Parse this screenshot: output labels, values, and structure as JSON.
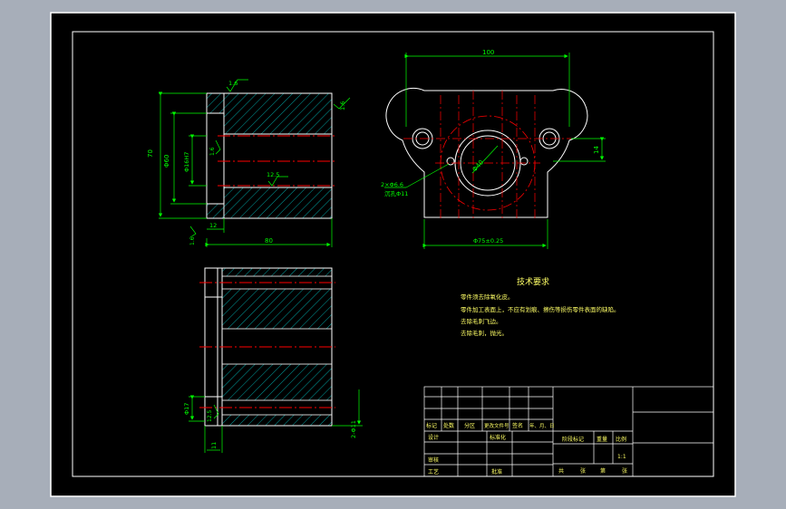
{
  "colors": {
    "app_background": "#a7aeb9",
    "canvas": "#000000",
    "border": "#ffffff",
    "dimension": "#00ff00",
    "centerline": "#ff0000",
    "hatch": "#00c8c8",
    "section_line": "#00c8c8",
    "text": "#ffff66",
    "title_text": "#ffff66"
  },
  "dims": {
    "top_chamfer": "1.6",
    "right_angle": "1.6",
    "left_height": "70",
    "outer_diameter": "Φ60",
    "inner_diameter": "Φ16H7",
    "inner_roughness": "1.6",
    "hole_roughness": "12.5",
    "flange_width": "12",
    "left_angle": "1.6",
    "total_length": "80",
    "plan_width": "100",
    "pcd_label": "Φ40",
    "center_dist": "14",
    "bolt_holes": "2×Φ6.6",
    "counterbore": "沉孔Φ11",
    "bottom_diameter": "Φ75±0.25",
    "sec_left": "Φ17",
    "sec_rough": "12.5",
    "sec_right": "2-Φ11",
    "sec_bottom": "11"
  },
  "notes": {
    "title": "技术要求",
    "lines": [
      "零件须去除氧化皮。",
      "零件加工表面上，不应有划痕、擦伤等损伤零件表面的缺陷。",
      "去除毛刺飞边。",
      "去除毛刺，抛光。"
    ]
  },
  "title_block": {
    "header_cols": [
      "标记",
      "处数",
      "分区",
      "更改文件号",
      "签名",
      "年、月、日"
    ],
    "left_rows": [
      "设计",
      "审核",
      "工艺"
    ],
    "mid_labels": [
      "标准化",
      "批准"
    ],
    "stage_labels": [
      "阶段标记",
      "重量",
      "比例"
    ],
    "scale": "1:1",
    "sheet_labels": [
      "共",
      "张",
      "第",
      "张"
    ]
  }
}
